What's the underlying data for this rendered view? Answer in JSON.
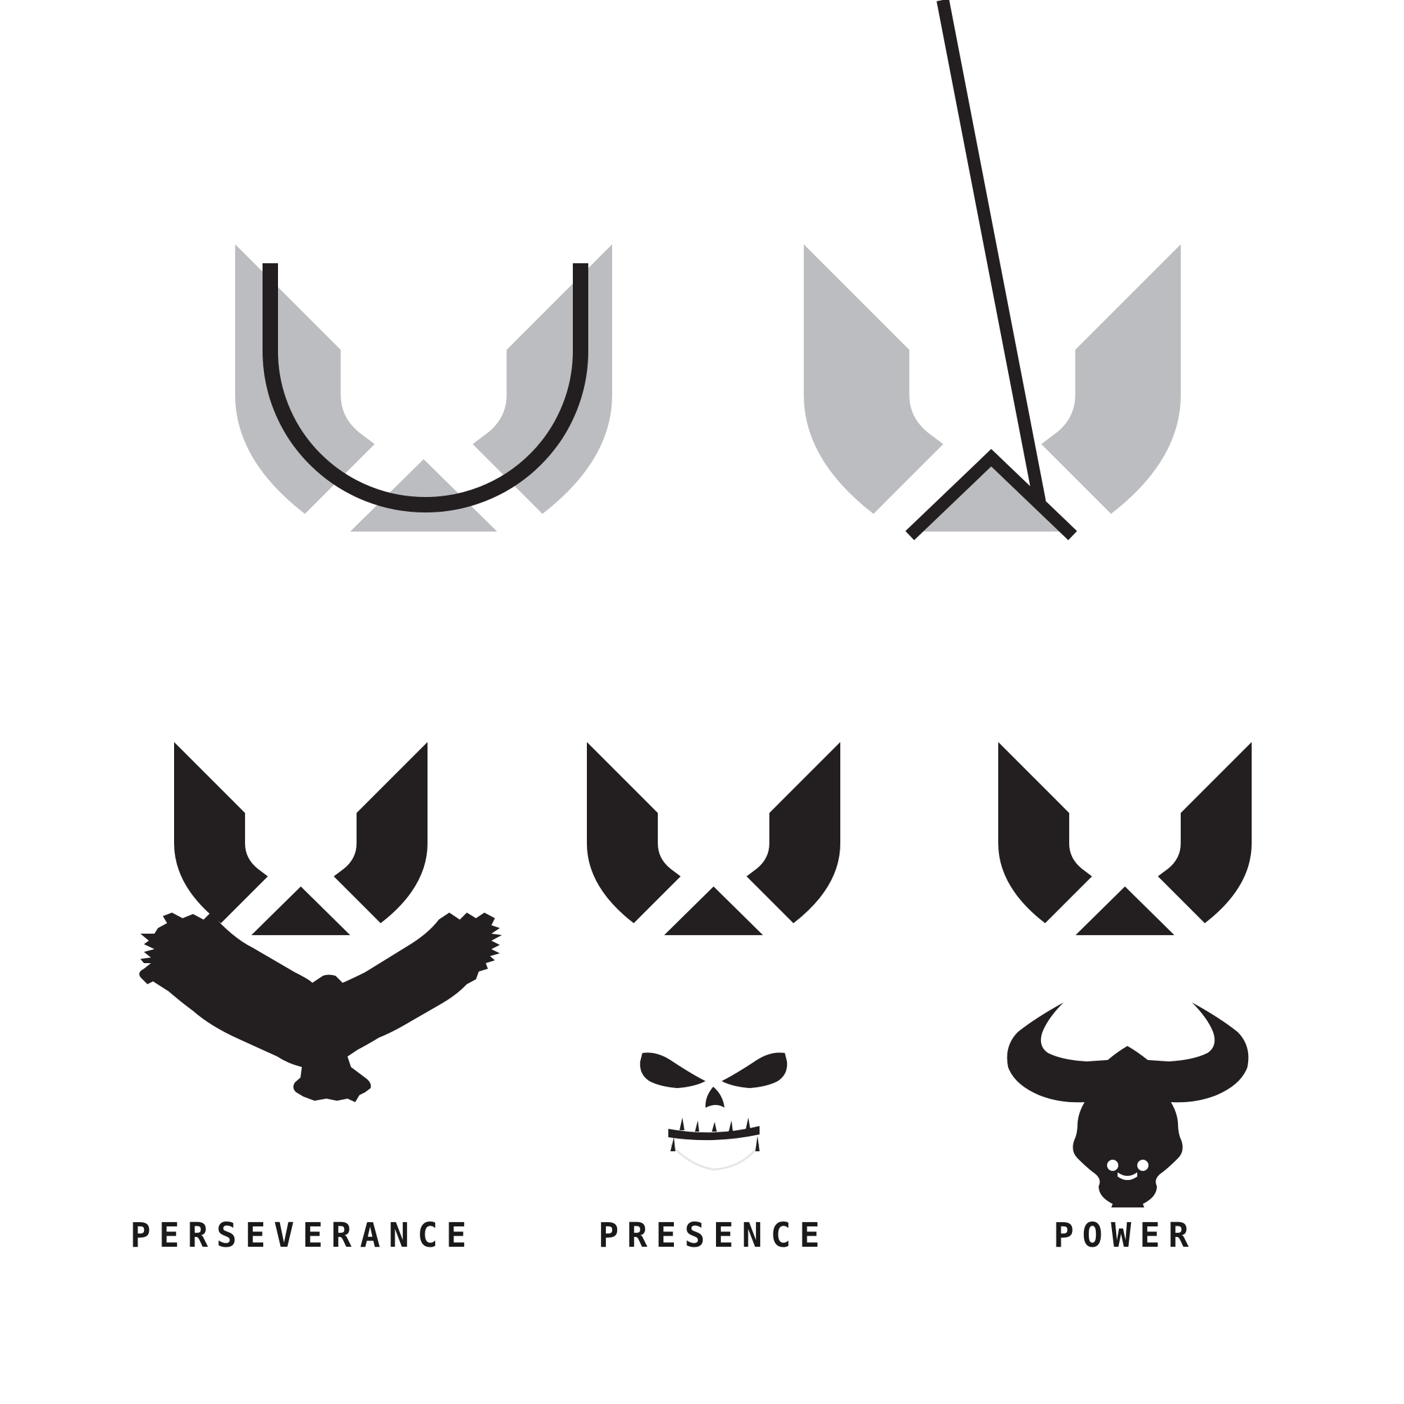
{
  "colors": {
    "background": "#ffffff",
    "ink": "#231f20",
    "grey": "#bcbdc0"
  },
  "marks": [
    {
      "name": "w-with-u-overlay",
      "icon": "w-logo-u-construction"
    },
    {
      "name": "w-with-a-overlay",
      "icon": "w-logo-a-construction"
    },
    {
      "name": "w-eagle",
      "icon": "eagle-icon",
      "label": "PERSEVERANCE"
    },
    {
      "name": "w-skull",
      "icon": "skull-icon",
      "label": "PRESENCE"
    },
    {
      "name": "w-bull",
      "icon": "bull-icon",
      "label": "POWER"
    }
  ]
}
